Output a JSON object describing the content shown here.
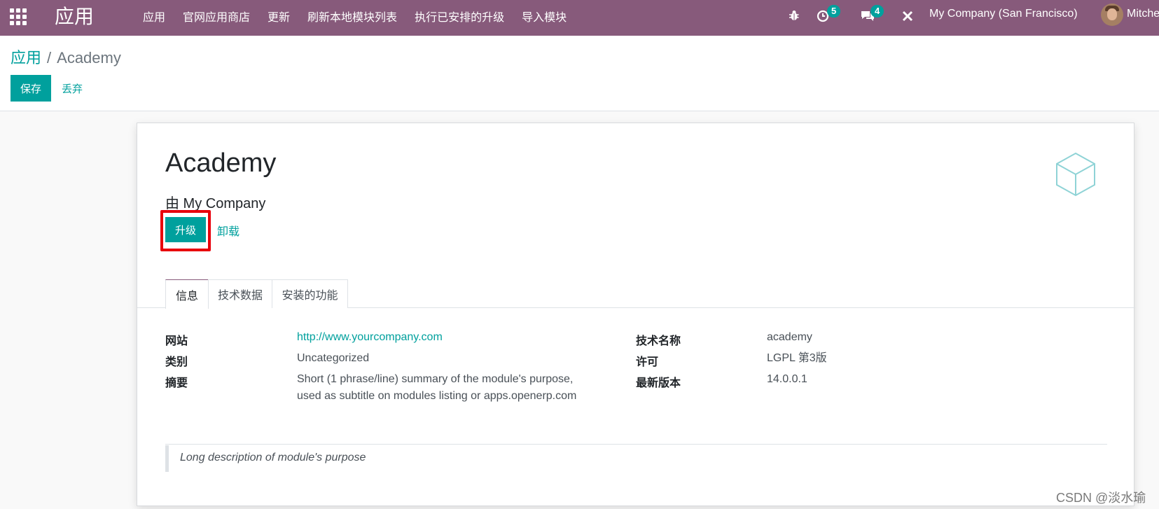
{
  "navbar": {
    "brand": "应用",
    "menu": [
      "应用",
      "官网应用商店",
      "更新",
      "刷新本地模块列表",
      "执行已安排的升级",
      "导入模块"
    ],
    "activity_count": "5",
    "message_count": "4",
    "company": "My Company (San Francisco)",
    "user": "Mitche"
  },
  "breadcrumb": {
    "parent": "应用",
    "separator": "/",
    "current": "Academy"
  },
  "toolbar": {
    "save": "保存",
    "discard": "丢弃"
  },
  "module": {
    "name": "Academy",
    "author": "由 My Company",
    "upgrade": "升级",
    "uninstall": "卸载"
  },
  "tabs": [
    "信息",
    "技术数据",
    "安装的功能"
  ],
  "info": {
    "website_label": "网站",
    "website_value": "http://www.yourcompany.com",
    "category_label": "类别",
    "category_value": "Uncategorized",
    "summary_label": "摘要",
    "summary_line1": "Short (1 phrase/line) summary of the module's purpose,",
    "summary_line2": "used as subtitle on modules listing or apps.openerp.com",
    "tech_name_label": "技术名称",
    "tech_name_value": "academy",
    "license_label": "许可",
    "license_value": "LGPL 第3版",
    "version_label": "最新版本",
    "version_value": "14.0.0.1"
  },
  "description": "Long description of module's purpose",
  "watermark": "CSDN @淡水瑜",
  "colors": {
    "navbar": "#875a7b",
    "accent": "#00a09d",
    "highlight": "#e8000b"
  }
}
